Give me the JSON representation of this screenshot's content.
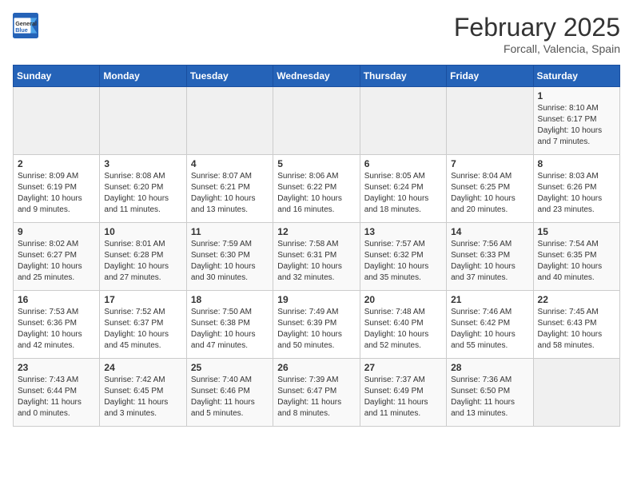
{
  "header": {
    "logo_general": "General",
    "logo_blue": "Blue",
    "month": "February 2025",
    "location": "Forcall, Valencia, Spain"
  },
  "weekdays": [
    "Sunday",
    "Monday",
    "Tuesday",
    "Wednesday",
    "Thursday",
    "Friday",
    "Saturday"
  ],
  "weeks": [
    [
      {
        "day": "",
        "info": ""
      },
      {
        "day": "",
        "info": ""
      },
      {
        "day": "",
        "info": ""
      },
      {
        "day": "",
        "info": ""
      },
      {
        "day": "",
        "info": ""
      },
      {
        "day": "",
        "info": ""
      },
      {
        "day": "1",
        "info": "Sunrise: 8:10 AM\nSunset: 6:17 PM\nDaylight: 10 hours\nand 7 minutes."
      }
    ],
    [
      {
        "day": "2",
        "info": "Sunrise: 8:09 AM\nSunset: 6:19 PM\nDaylight: 10 hours\nand 9 minutes."
      },
      {
        "day": "3",
        "info": "Sunrise: 8:08 AM\nSunset: 6:20 PM\nDaylight: 10 hours\nand 11 minutes."
      },
      {
        "day": "4",
        "info": "Sunrise: 8:07 AM\nSunset: 6:21 PM\nDaylight: 10 hours\nand 13 minutes."
      },
      {
        "day": "5",
        "info": "Sunrise: 8:06 AM\nSunset: 6:22 PM\nDaylight: 10 hours\nand 16 minutes."
      },
      {
        "day": "6",
        "info": "Sunrise: 8:05 AM\nSunset: 6:24 PM\nDaylight: 10 hours\nand 18 minutes."
      },
      {
        "day": "7",
        "info": "Sunrise: 8:04 AM\nSunset: 6:25 PM\nDaylight: 10 hours\nand 20 minutes."
      },
      {
        "day": "8",
        "info": "Sunrise: 8:03 AM\nSunset: 6:26 PM\nDaylight: 10 hours\nand 23 minutes."
      }
    ],
    [
      {
        "day": "9",
        "info": "Sunrise: 8:02 AM\nSunset: 6:27 PM\nDaylight: 10 hours\nand 25 minutes."
      },
      {
        "day": "10",
        "info": "Sunrise: 8:01 AM\nSunset: 6:28 PM\nDaylight: 10 hours\nand 27 minutes."
      },
      {
        "day": "11",
        "info": "Sunrise: 7:59 AM\nSunset: 6:30 PM\nDaylight: 10 hours\nand 30 minutes."
      },
      {
        "day": "12",
        "info": "Sunrise: 7:58 AM\nSunset: 6:31 PM\nDaylight: 10 hours\nand 32 minutes."
      },
      {
        "day": "13",
        "info": "Sunrise: 7:57 AM\nSunset: 6:32 PM\nDaylight: 10 hours\nand 35 minutes."
      },
      {
        "day": "14",
        "info": "Sunrise: 7:56 AM\nSunset: 6:33 PM\nDaylight: 10 hours\nand 37 minutes."
      },
      {
        "day": "15",
        "info": "Sunrise: 7:54 AM\nSunset: 6:35 PM\nDaylight: 10 hours\nand 40 minutes."
      }
    ],
    [
      {
        "day": "16",
        "info": "Sunrise: 7:53 AM\nSunset: 6:36 PM\nDaylight: 10 hours\nand 42 minutes."
      },
      {
        "day": "17",
        "info": "Sunrise: 7:52 AM\nSunset: 6:37 PM\nDaylight: 10 hours\nand 45 minutes."
      },
      {
        "day": "18",
        "info": "Sunrise: 7:50 AM\nSunset: 6:38 PM\nDaylight: 10 hours\nand 47 minutes."
      },
      {
        "day": "19",
        "info": "Sunrise: 7:49 AM\nSunset: 6:39 PM\nDaylight: 10 hours\nand 50 minutes."
      },
      {
        "day": "20",
        "info": "Sunrise: 7:48 AM\nSunset: 6:40 PM\nDaylight: 10 hours\nand 52 minutes."
      },
      {
        "day": "21",
        "info": "Sunrise: 7:46 AM\nSunset: 6:42 PM\nDaylight: 10 hours\nand 55 minutes."
      },
      {
        "day": "22",
        "info": "Sunrise: 7:45 AM\nSunset: 6:43 PM\nDaylight: 10 hours\nand 58 minutes."
      }
    ],
    [
      {
        "day": "23",
        "info": "Sunrise: 7:43 AM\nSunset: 6:44 PM\nDaylight: 11 hours\nand 0 minutes."
      },
      {
        "day": "24",
        "info": "Sunrise: 7:42 AM\nSunset: 6:45 PM\nDaylight: 11 hours\nand 3 minutes."
      },
      {
        "day": "25",
        "info": "Sunrise: 7:40 AM\nSunset: 6:46 PM\nDaylight: 11 hours\nand 5 minutes."
      },
      {
        "day": "26",
        "info": "Sunrise: 7:39 AM\nSunset: 6:47 PM\nDaylight: 11 hours\nand 8 minutes."
      },
      {
        "day": "27",
        "info": "Sunrise: 7:37 AM\nSunset: 6:49 PM\nDaylight: 11 hours\nand 11 minutes."
      },
      {
        "day": "28",
        "info": "Sunrise: 7:36 AM\nSunset: 6:50 PM\nDaylight: 11 hours\nand 13 minutes."
      },
      {
        "day": "",
        "info": ""
      }
    ]
  ]
}
